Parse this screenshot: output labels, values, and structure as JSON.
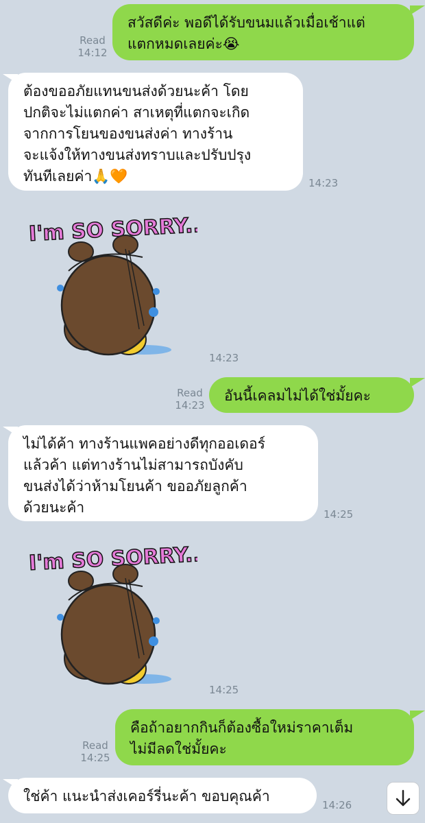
{
  "messages": [
    {
      "text": "สวัสดีค่ะ พอดีได้รับขนมแล้วเมื่อเช้าแต่\nแตกหมดเลยค่ะ😭",
      "status": "Read",
      "time": "14:12"
    },
    {
      "text": "ต้องขออภัยแทนขนส่งด้วยนะค้า  โดย\nปกติจะไม่แตกค่า สาเหตุที่แตกจะเกิด\nจากการโยนของขนส่งค่า ทางร้าน\nจะแจ้งให้ทางขนส่งทราบและปรับปรุง\nทันทีเลยค่า🙏🧡",
      "time": "14:23"
    },
    {
      "sticker_text": "I'm SO SORRY..",
      "time": "14:23"
    },
    {
      "text": "อันนี้เคลมไม่ได้ใช่มั้ยคะ",
      "status": "Read",
      "time": "14:23"
    },
    {
      "text": "ไม่ได้ค้า ทางร้านแพคอย่างดีทุกออเดอร์\nแล้วค้า แต่ทางร้านไม่สามารถบังคับ\nขนส่งได้ว่าห้ามโยนค้า ขออภัยลูกค้า\nด้วยนะค้า",
      "time": "14:25"
    },
    {
      "sticker_text": "I'm SO SORRY..",
      "time": "14:25"
    },
    {
      "text": "คือถ้าอยากกินก็ต้องซื้อใหม่ราคาเต็ม\nไม่มีลดใช่มั้ยคะ",
      "status": "Read",
      "time": "14:25"
    },
    {
      "text": "ใช่ค้า แนะนำส่งเคอร์รี่นะค้า ขอบคุณค้า",
      "time": "14:26"
    }
  ],
  "colors": {
    "background": "#d0d9e3",
    "outgoing": "#8fd84b",
    "incoming": "#ffffff"
  },
  "icons": {
    "scroll": "arrow-down-icon"
  }
}
